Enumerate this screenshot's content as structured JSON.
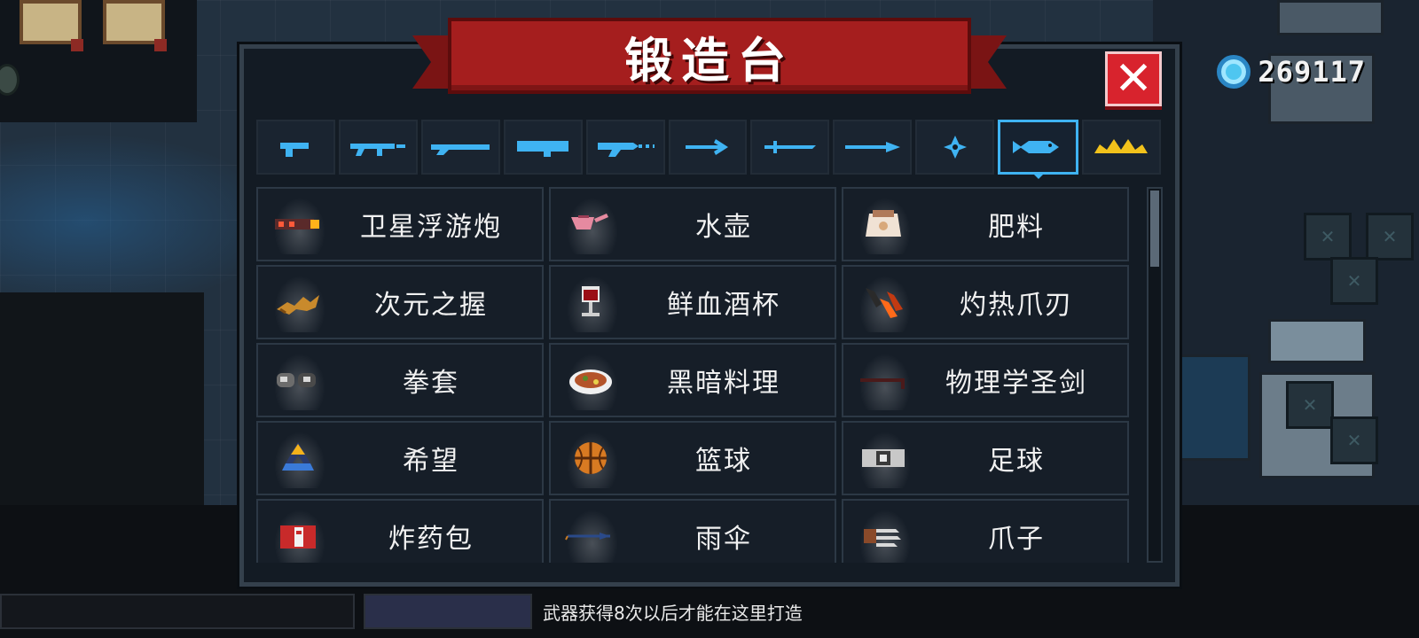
{
  "currency": {
    "icon": "gem-icon",
    "value": "269117"
  },
  "forge": {
    "title": "锻造台",
    "close_icon": "close-x-icon",
    "tabs": [
      {
        "icon": "pistol-icon",
        "active": false
      },
      {
        "icon": "assault-rifle-icon",
        "active": false
      },
      {
        "icon": "shotgun-icon",
        "active": false
      },
      {
        "icon": "launcher-icon",
        "active": false
      },
      {
        "icon": "laser-rifle-icon",
        "active": false
      },
      {
        "icon": "bow-icon",
        "active": false
      },
      {
        "icon": "sword-icon",
        "active": false
      },
      {
        "icon": "spear-icon",
        "active": false
      },
      {
        "icon": "shuriken-icon",
        "active": false
      },
      {
        "icon": "fish-icon",
        "active": true
      },
      {
        "icon": "crown-icon",
        "active": false
      }
    ],
    "items": [
      {
        "label": "卫星浮游炮",
        "icon": "satellite-cannon-icon"
      },
      {
        "label": "水壶",
        "icon": "watering-can-icon"
      },
      {
        "label": "肥料",
        "icon": "fertilizer-sack-icon"
      },
      {
        "label": "次元之握",
        "icon": "dimension-grip-icon"
      },
      {
        "label": "鲜血酒杯",
        "icon": "blood-goblet-icon"
      },
      {
        "label": "灼热爪刃",
        "icon": "burning-claw-icon"
      },
      {
        "label": "拳套",
        "icon": "boxing-gloves-icon"
      },
      {
        "label": "黑暗料理",
        "icon": "dark-cuisine-icon"
      },
      {
        "label": "物理学圣剑",
        "icon": "crowbar-icon"
      },
      {
        "label": "希望",
        "icon": "praying-hands-icon"
      },
      {
        "label": "篮球",
        "icon": "basketball-icon"
      },
      {
        "label": "足球",
        "icon": "football-icon"
      },
      {
        "label": "炸药包",
        "icon": "dynamite-icon"
      },
      {
        "label": "雨伞",
        "icon": "umbrella-icon"
      },
      {
        "label": "爪子",
        "icon": "claw-icon"
      }
    ],
    "scroll_fraction": 0.2
  },
  "hint_text": "武器获得8次以后才能在这里打造",
  "colors": {
    "banner_red": "#a51e1e",
    "close_red": "#d8232d",
    "tab_icon_blue": "#3fb3f2",
    "crown_gold": "#f2c21b",
    "panel_bg": "#131b24"
  }
}
